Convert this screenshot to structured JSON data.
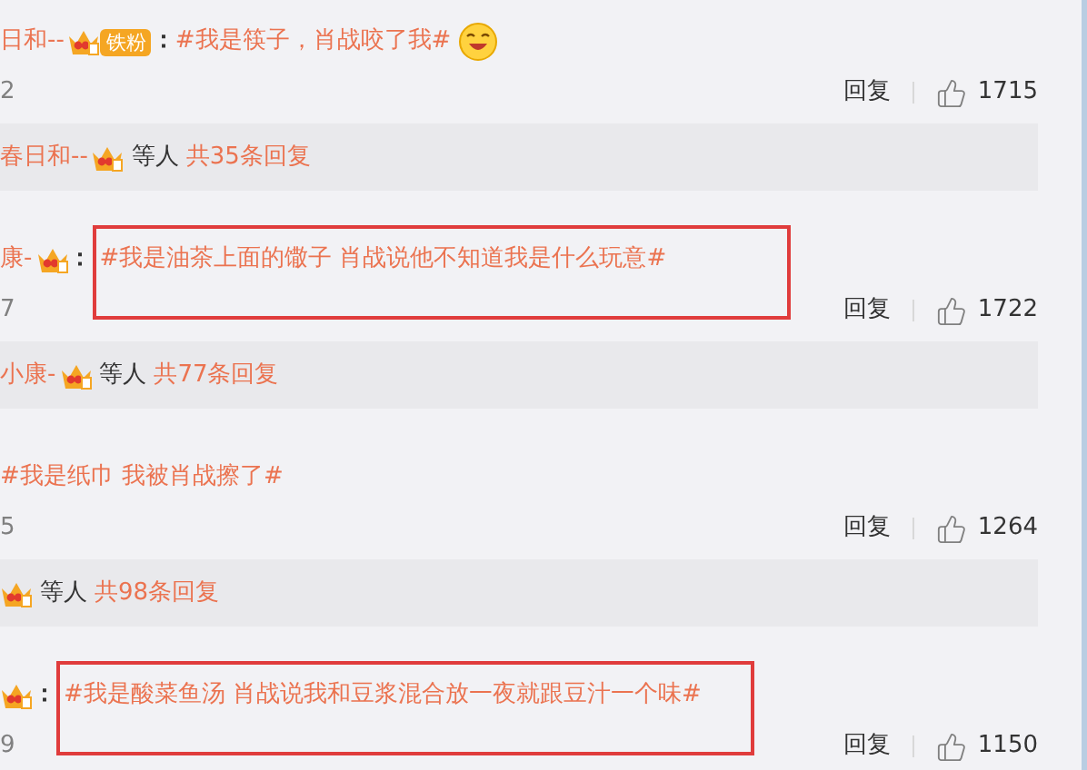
{
  "comments": [
    {
      "user": "日和--",
      "badge": "铁粉",
      "sep": "：",
      "text": "#我是筷子，肖战咬了我#",
      "emoji": true,
      "highlighted": false,
      "time": "2",
      "reply": "回复",
      "likes": "1715",
      "thread": {
        "user": "春日和--",
        "others": "等人",
        "count": "共35条回复"
      }
    },
    {
      "user": "康-",
      "sep": "：",
      "text": "#我是油茶上面的馓子 肖战说他不知道我是什么玩意#",
      "highlighted": true,
      "time": "7",
      "reply": "回复",
      "likes": "1722",
      "thread": {
        "user": "小康-",
        "others": "等人",
        "count": "共77条回复"
      }
    },
    {
      "text": "#我是纸巾 我被肖战擦了#",
      "highlighted": false,
      "time": "5",
      "reply": "回复",
      "likes": "1264",
      "thread": {
        "others": "等人",
        "count": "共98条回复"
      }
    },
    {
      "sep": "：",
      "text": "#我是酸菜鱼汤 肖战说我和豆浆混合放一夜就跟豆汁一个味#",
      "highlighted": true,
      "time": "9",
      "reply": "回复",
      "likes": "1150"
    }
  ]
}
